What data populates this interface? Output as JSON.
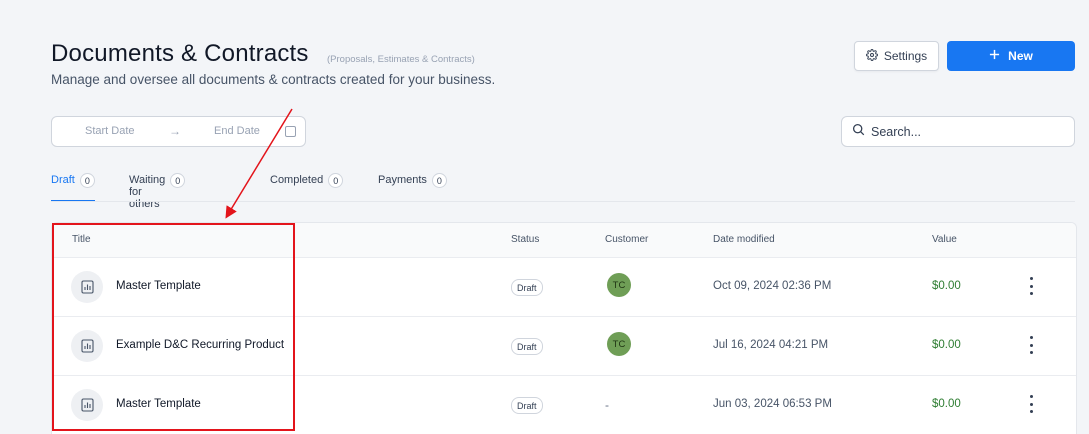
{
  "header": {
    "title": "Documents & Contracts",
    "subtitle": "(Proposals, Estimates & Contracts)",
    "description": "Manage and oversee all documents & contracts created for your business.",
    "settings_label": "Settings",
    "new_label": "New"
  },
  "filters": {
    "start_date_placeholder": "Start Date",
    "arrow": "→",
    "end_date_placeholder": "End Date",
    "search_placeholder": "Search..."
  },
  "tabs": [
    {
      "label": "Draft",
      "count": "0",
      "active": true
    },
    {
      "label": "Waiting for others",
      "count": "0",
      "active": false
    },
    {
      "label": "Completed",
      "count": "0",
      "active": false
    },
    {
      "label": "Payments",
      "count": "0",
      "active": false
    }
  ],
  "table": {
    "headers": {
      "title": "Title",
      "status": "Status",
      "customer": "Customer",
      "date_modified": "Date modified",
      "value": "Value"
    },
    "rows": [
      {
        "title": "Master Template",
        "status": "Draft",
        "customer": "TC",
        "date": "Oct 09, 2024 02:36 PM",
        "value": "$0.00"
      },
      {
        "title": "Example D&C Recurring Product",
        "status": "Draft",
        "customer": "TC",
        "date": "Jul 16, 2024 04:21 PM",
        "value": "$0.00"
      },
      {
        "title": "Master Template",
        "status": "Draft",
        "customer": "-",
        "date": "Jun 03, 2024 06:53 PM",
        "value": "$0.00"
      }
    ]
  },
  "colors": {
    "accent": "#1877f2",
    "value_green": "#2e7d32",
    "avatar_green": "#6f9e56",
    "annotation_red": "#e3141b"
  },
  "icons": {
    "settings": "gear-icon",
    "new": "plus-icon",
    "search": "search-icon",
    "row": "document-chart-icon",
    "actions": "kebab-menu-icon"
  }
}
